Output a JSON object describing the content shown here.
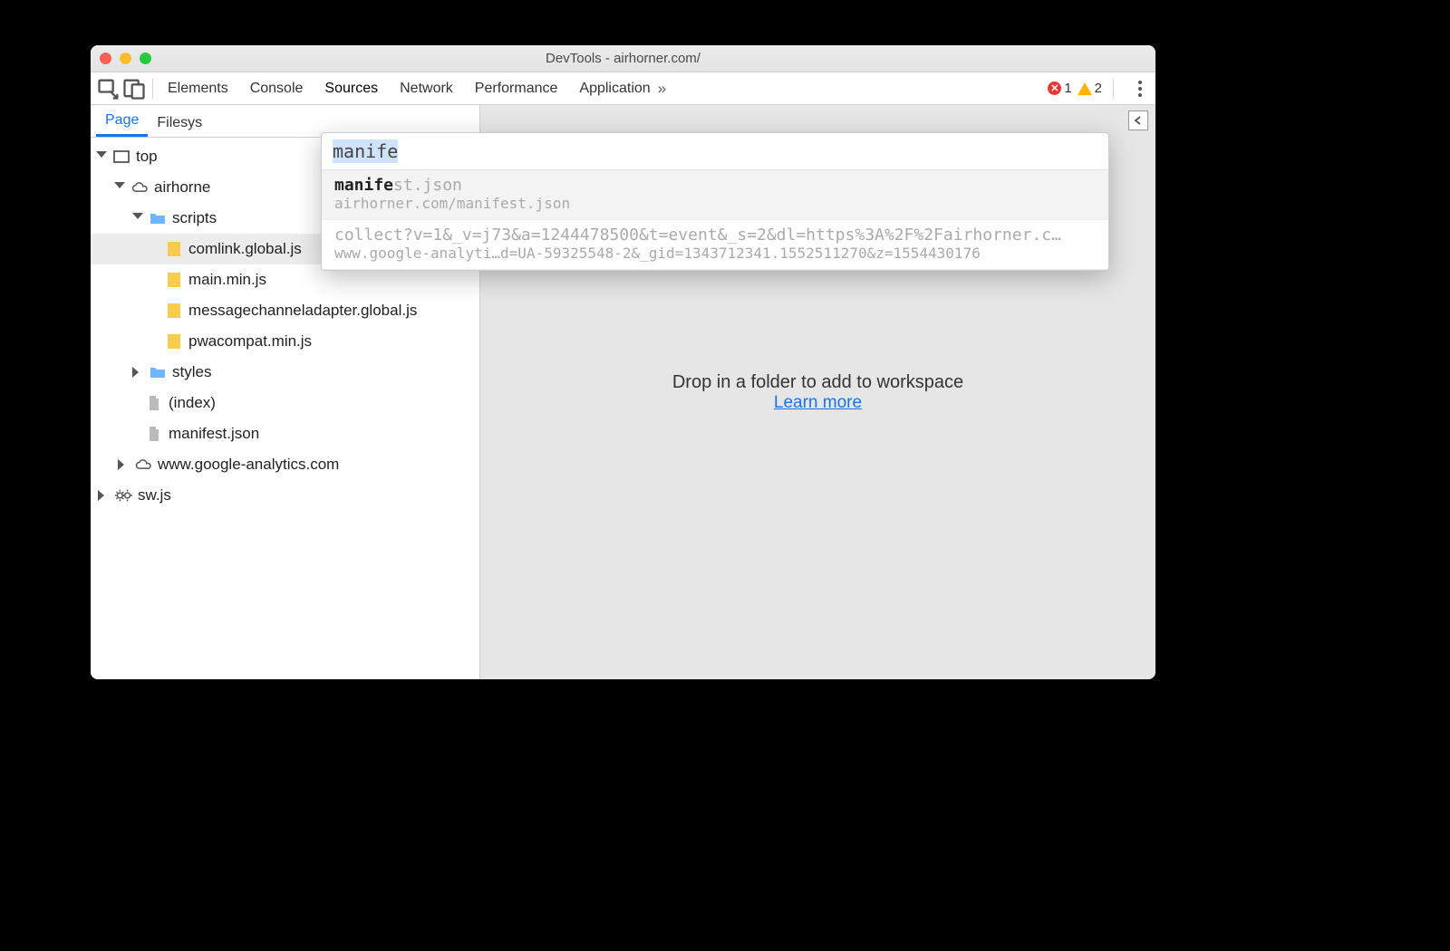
{
  "window": {
    "title": "DevTools - airhorner.com/"
  },
  "toolbar": {
    "tabs": [
      "Elements",
      "Console",
      "Sources",
      "Network",
      "Performance",
      "Application"
    ],
    "active_tab_index": 2,
    "error_count": "1",
    "warning_count": "2"
  },
  "sidebar": {
    "tabs": [
      "Page",
      "Filesys"
    ],
    "active_tab_index": 0,
    "tree": {
      "top": "top",
      "domain": "airhorne",
      "scripts_folder": "scripts",
      "scripts": [
        "comlink.global.js",
        "main.min.js",
        "messagechanneladapter.global.js",
        "pwacompat.min.js"
      ],
      "styles_folder": "styles",
      "index_file": "(index)",
      "manifest_file": "manifest.json",
      "analytics_domain": "www.google-analytics.com",
      "sw_file": "sw.js"
    }
  },
  "workspace": {
    "drop_message": "Drop in a folder to add to workspace",
    "learn_more": "Learn more"
  },
  "search": {
    "query": "manife",
    "results": [
      {
        "title_match": "manife",
        "title_rest": "st.json",
        "subtitle": "airhorner.com/manifest.json"
      },
      {
        "title_match": "",
        "title_rest": "collect?v=1&_v=j73&a=1244478500&t=event&_s=2&dl=https%3A%2F%2Fairhorner.c…",
        "subtitle": "www.google-analyti…d=UA-59325548-2&_gid=1343712341.1552511270&z=1554430176"
      }
    ],
    "selected_index": 0
  }
}
